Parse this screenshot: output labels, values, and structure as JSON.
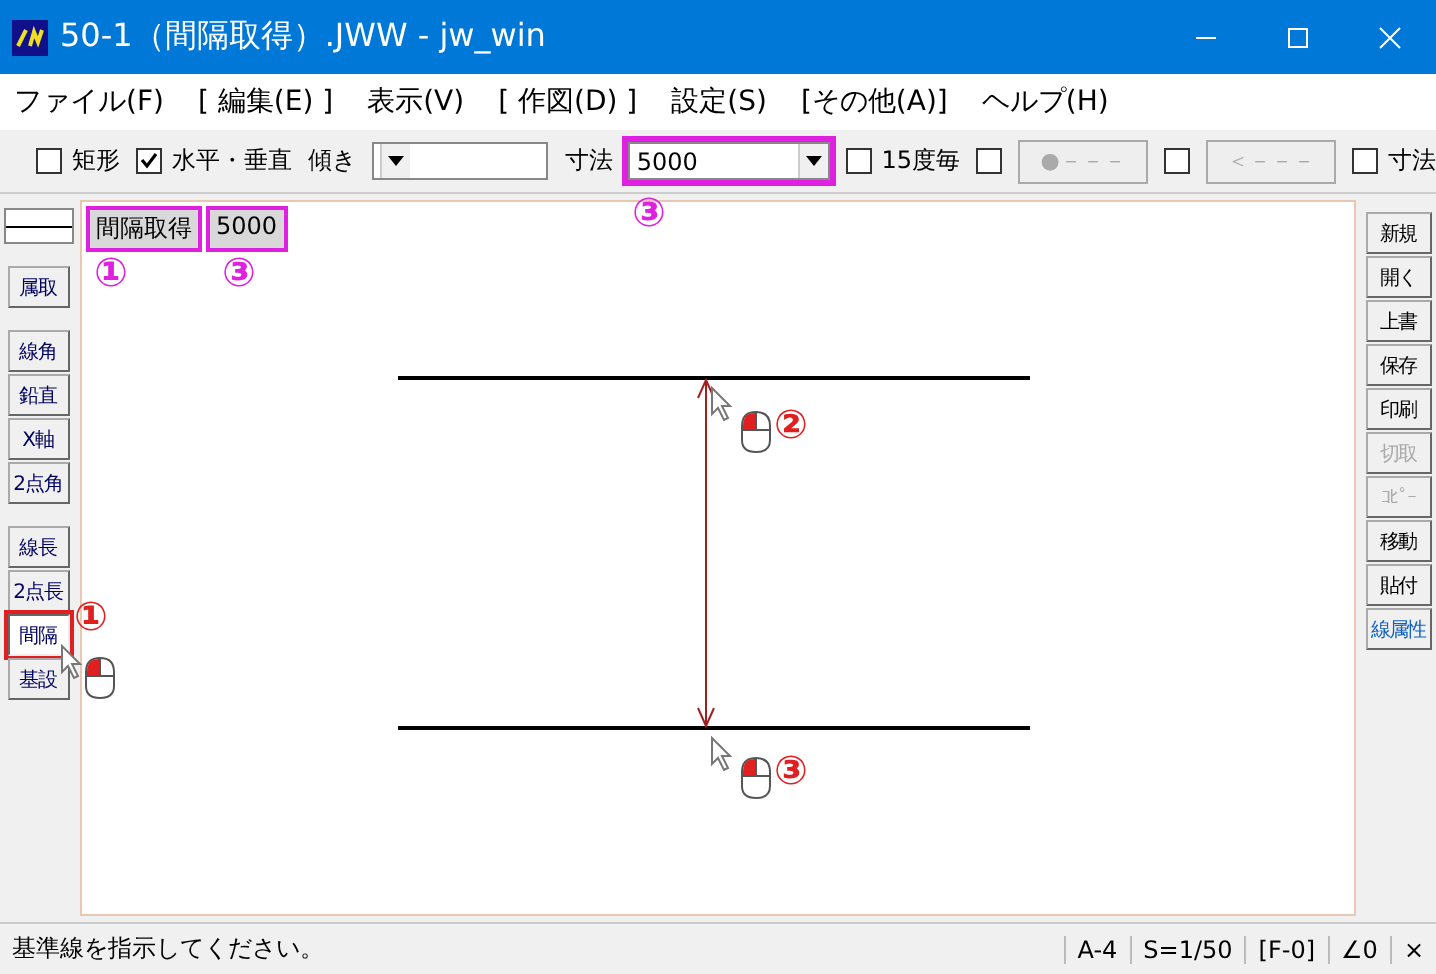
{
  "window": {
    "title": "50-1（間隔取得）.JWW - jw_win"
  },
  "menu": [
    "ファイル(F)",
    "[ 編集(E) ]",
    "表示(V)",
    "[ 作図(D) ]",
    "設定(S)",
    "[その他(A)]",
    "ヘルプ(H)"
  ],
  "toolbar": [
    {
      "kind": "checkbox",
      "label": "矩形",
      "checked": false
    },
    {
      "kind": "checkbox",
      "label": "水平・垂直",
      "checked": true
    },
    {
      "kind": "label",
      "label": "傾き"
    },
    {
      "kind": "combo",
      "highlighted": false
    },
    {
      "kind": "label",
      "label": "寸法"
    },
    {
      "kind": "combo",
      "value": "5000",
      "highlighted": true
    },
    {
      "kind": "checkbox",
      "label": "15度毎",
      "checked": false
    },
    {
      "kind": "checkbox",
      "checked": false
    },
    {
      "kind": "button",
      "label": "●－－－",
      "disabled": true
    },
    {
      "kind": "checkbox",
      "checked": false
    },
    {
      "kind": "button",
      "label": "＜－－－",
      "disabled": true
    },
    {
      "kind": "checkbox",
      "label": "寸法",
      "checked": false
    }
  ],
  "left_toolbar": {
    "groups": [
      [
        {
          "label": "属取",
          "selected": false
        }
      ],
      [
        {
          "label": "線角",
          "selected": false
        },
        {
          "label": "鉛直",
          "selected": false
        },
        {
          "label": "X軸",
          "selected": false
        },
        {
          "label": "2点角",
          "selected": false
        }
      ],
      [
        {
          "label": "線長",
          "selected": false
        },
        {
          "label": "2点長",
          "selected": false
        },
        {
          "label": "間隔",
          "selected": true
        },
        {
          "label": "基設",
          "selected": false
        }
      ]
    ]
  },
  "right_toolbar": [
    {
      "label": "新規",
      "disabled": false,
      "accent": false
    },
    {
      "label": "開く",
      "disabled": false,
      "accent": false
    },
    {
      "label": "上書",
      "disabled": false,
      "accent": false
    },
    {
      "label": "保存",
      "disabled": false,
      "accent": false
    },
    {
      "label": "印刷",
      "disabled": false,
      "accent": false
    },
    {
      "label": "切取",
      "disabled": true,
      "accent": false
    },
    {
      "label": "ｺﾋﾟｰ",
      "disabled": true,
      "accent": false
    },
    {
      "label": "移動",
      "disabled": false,
      "accent": false
    },
    {
      "label": "貼付",
      "disabled": false,
      "accent": false
    },
    {
      "label": "線属性",
      "disabled": false,
      "accent": true
    }
  ],
  "canvas": {
    "status_labels": [
      {
        "text": "間隔取得",
        "highlighted": true
      },
      {
        "text": "5000",
        "highlighted": true
      }
    ]
  },
  "annotations": [
    {
      "text": "③",
      "color": "#e020e0"
    },
    {
      "text": "①",
      "color": "#e020e0"
    },
    {
      "text": "③",
      "color": "#e020e0"
    },
    {
      "text": "①",
      "color": "#e02020"
    },
    {
      "text": "②",
      "color": "#e02020"
    },
    {
      "text": "③",
      "color": "#e02020"
    }
  ],
  "status_bar": {
    "message": "基準線を指示してください。",
    "fields": [
      "A-4",
      "S=1/50",
      "[F-0]",
      "∠0",
      "×"
    ]
  }
}
